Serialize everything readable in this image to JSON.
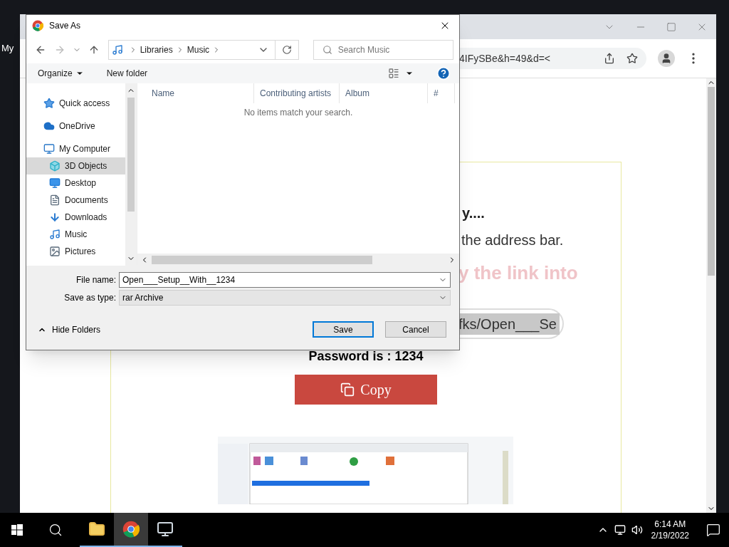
{
  "desktop": {
    "icons": [
      {
        "label": "My"
      }
    ]
  },
  "browser": {
    "url": "4IFySBe&h=49&d=<",
    "page": {
      "heading": "y....",
      "line": "the address bar.",
      "hint": "y the link into",
      "link_field": "fks/Open___Se",
      "password": "Password is : 1234",
      "copy_button": "Copy"
    }
  },
  "dialog": {
    "title": "Save As",
    "breadcrumb": [
      "Libraries",
      "Music"
    ],
    "search": {
      "placeholder": "Search Music"
    },
    "toolbar": {
      "organize": "Organize",
      "new_folder": "New folder"
    },
    "sidebar": {
      "items": [
        {
          "label": "Quick access",
          "selected": false
        },
        {
          "label": "OneDrive",
          "selected": false
        },
        {
          "label": "My Computer",
          "selected": false,
          "children": [
            {
              "label": "3D Objects",
              "selected": true
            },
            {
              "label": "Desktop",
              "selected": false
            },
            {
              "label": "Documents",
              "selected": false
            },
            {
              "label": "Downloads",
              "selected": false
            },
            {
              "label": "Music",
              "selected": false
            },
            {
              "label": "Pictures",
              "selected": false
            }
          ]
        }
      ]
    },
    "columns": [
      "Name",
      "Contributing artists",
      "Album",
      "#"
    ],
    "empty_message": "No items match your search.",
    "file_name": {
      "label": "File name:",
      "value": "Open___Setup__With__1234"
    },
    "save_type": {
      "label": "Save as type:",
      "value": "rar Archive"
    },
    "hide_folders": "Hide Folders",
    "buttons": [
      {
        "label": "Save",
        "default": true
      },
      {
        "label": "Cancel",
        "default": false
      }
    ]
  },
  "taskbar": {
    "apps": [
      {
        "selected": false
      },
      {
        "selected": true
      },
      {
        "selected": false
      }
    ],
    "time": "6:14 AM",
    "date": "2/19/2022"
  }
}
